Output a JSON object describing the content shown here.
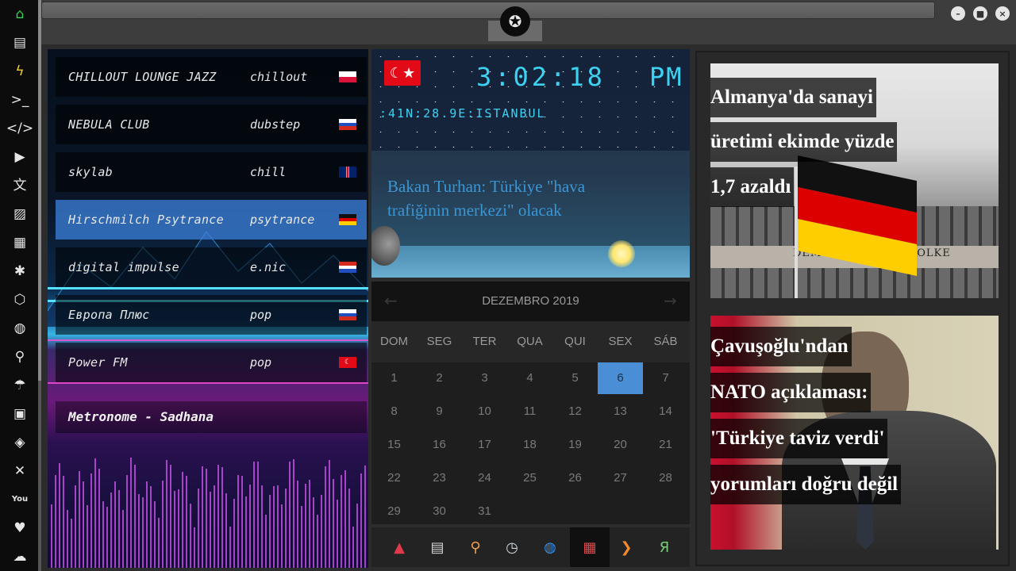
{
  "rail": {
    "icons": [
      "home-icon",
      "document-icon",
      "bolt-icon",
      "terminal-icon",
      "code-icon",
      "play-icon",
      "translate-icon",
      "image-icon",
      "news-icon",
      "asterisk-icon",
      "hexagon-icon",
      "globe-icon",
      "search-icon",
      "umbrella-icon",
      "contact-icon",
      "tag-icon",
      "shuffle-icon",
      "youtube-icon",
      "heart-icon",
      "cloud-icon"
    ],
    "glyphs": [
      "⌂",
      "▤",
      "ϟ",
      ">_",
      "</>",
      "▶",
      "文",
      "▨",
      "▦",
      "✱",
      "⬡",
      "◍",
      "⚲",
      "☂",
      "▣",
      "◈",
      "✕",
      "You",
      "♥",
      "☁"
    ]
  },
  "window": {
    "minimize": "–",
    "maximize": "■",
    "close": "×",
    "emblem": "✪"
  },
  "radio": {
    "stations": [
      {
        "name": "CHILLOUT LOUNGE JAZZ",
        "genre": "chillout",
        "flag": "pl"
      },
      {
        "name": "NEBULA CLUB",
        "genre": "dubstep",
        "flag": "ru"
      },
      {
        "name": "skylab",
        "genre": "chill",
        "flag": "gb"
      },
      {
        "name": "Hirschmilch Psytrance",
        "genre": "psytrance",
        "flag": "de"
      },
      {
        "name": "digital impulse",
        "genre": "e.nic",
        "flag": "hr"
      },
      {
        "name": "Европа Плюс",
        "genre": "pop",
        "flag": "ru"
      },
      {
        "name": "Power FM",
        "genre": "pop",
        "flag": "tr"
      }
    ],
    "active_index": 3,
    "now_playing": "Metronome - Sadhana"
  },
  "clock": {
    "flag_glyph": "☾★",
    "time": "3:02:18",
    "ampm": "PM",
    "coords": ":41N:28.9E:ISTANBUL",
    "headline": "Bakan Turhan: Türkiye \"hava trafiğinin merkezi\" olacak",
    "colors": {
      "digits": "#3ed2f2",
      "headline": "#3a96d4"
    }
  },
  "calendar": {
    "month": "DEZEMBRO 2019",
    "prev": "←",
    "next": "→",
    "weekdays": [
      "DOM",
      "SEG",
      "TER",
      "QUA",
      "QUI",
      "SEX",
      "SÁB"
    ],
    "days": [
      "1",
      "2",
      "3",
      "4",
      "5",
      "6",
      "7",
      "8",
      "9",
      "10",
      "11",
      "12",
      "13",
      "14",
      "15",
      "16",
      "17",
      "18",
      "19",
      "20",
      "21",
      "22",
      "23",
      "24",
      "25",
      "26",
      "27",
      "28",
      "29",
      "30",
      "31"
    ],
    "today": "6",
    "today_color": "#4a8fd6"
  },
  "dock": {
    "apps": [
      {
        "icon": "launcher-icon",
        "glyph": "▲",
        "color": "#e0394a"
      },
      {
        "icon": "news-reader-icon",
        "glyph": "▤",
        "color": "#d8d8d8"
      },
      {
        "icon": "search-app-icon",
        "glyph": "⚲",
        "color": "#f0a050"
      },
      {
        "icon": "clock-app-icon",
        "glyph": "◷",
        "color": "#cfd8e0"
      },
      {
        "icon": "globe-app-icon",
        "glyph": "◍",
        "color": "#3a8ee6"
      },
      {
        "icon": "calendar-app-icon",
        "glyph": "▦",
        "color": "#e04a4a"
      },
      {
        "icon": "forward-app-icon",
        "glyph": "❯",
        "color": "#f08a2a"
      },
      {
        "icon": "yandex-app-icon",
        "glyph": "Я",
        "color": "#7acb7a"
      }
    ]
  },
  "news": [
    {
      "lines": [
        "Almanya'da sanayi",
        "üretimi ekimde yüzde",
        "1,7 azaldı"
      ],
      "inscription": "DEM DEUTSCHEN VOLKE"
    },
    {
      "lines": [
        "Çavuşoğlu'ndan",
        "NATO açıklaması:",
        "'Türkiye taviz verdi'",
        "yorumları doğru değil"
      ]
    }
  ]
}
